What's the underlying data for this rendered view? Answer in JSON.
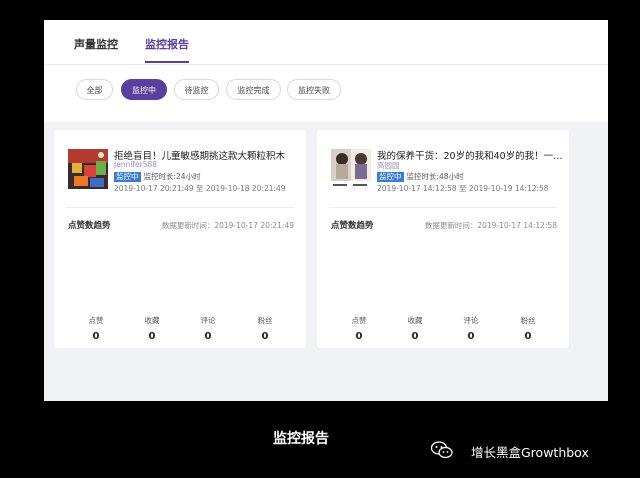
{
  "tabs": [
    {
      "label": "声量监控"
    },
    {
      "label": "监控报告"
    }
  ],
  "filters": [
    "全部",
    "监控中",
    "待监控",
    "监控完成",
    "监控失败"
  ],
  "cards": [
    {
      "title": "拒绝盲目！儿童敏感期挑这款大颗粒积木",
      "author": "Jennifer588",
      "badge": "监控中",
      "duration": "监控时长:24小时",
      "range": "2019-10-17 20:21:49 至 2019-10-18 20:21:49",
      "trend_label": "点赞数趋势",
      "update_time": "数据更新时间：2019-10-17 20:21:49",
      "stats": [
        {
          "label": "点赞",
          "value": "0"
        },
        {
          "label": "收藏",
          "value": "0"
        },
        {
          "label": "评论",
          "value": "0"
        },
        {
          "label": "粉丝",
          "value": "0"
        }
      ]
    },
    {
      "title": "我的保养干货：20岁的我和40岁的我！一…",
      "author": "高园园",
      "badge": "监控中",
      "duration": "监控时长:48小时",
      "range": "2019-10-17 14:12:58 至 2019-10-19 14:12:58",
      "trend_label": "点赞数趋势",
      "update_time": "数据更新时间：2019-10-17 14:12:58",
      "stats": [
        {
          "label": "点赞",
          "value": "0"
        },
        {
          "label": "收藏",
          "value": "0"
        },
        {
          "label": "评论",
          "value": "0"
        },
        {
          "label": "粉丝",
          "value": "0"
        }
      ]
    }
  ],
  "caption": "监控报告",
  "brand": {
    "text": "增长黑盒Growthbox",
    "icon": "wechat-icon"
  },
  "colors": {
    "accent": "#5b3f9e",
    "badge": "#3a7bd5",
    "background": "#f0f2f5"
  }
}
